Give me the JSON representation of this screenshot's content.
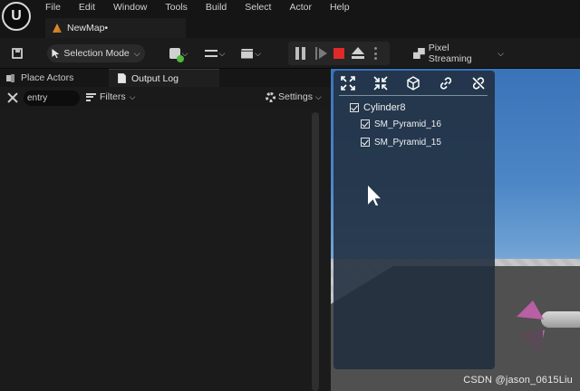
{
  "menu": {
    "items": [
      {
        "label": "File"
      },
      {
        "label": "Edit"
      },
      {
        "label": "Window"
      },
      {
        "label": "Tools"
      },
      {
        "label": "Build"
      },
      {
        "label": "Select"
      },
      {
        "label": "Actor"
      },
      {
        "label": "Help"
      }
    ]
  },
  "logo_icon": "unreal-logo-icon",
  "logo_mark": "U",
  "map_tab": {
    "label": "NewMap•"
  },
  "toolbar": {
    "selection_mode": "Selection Mode",
    "chevron": "⌵",
    "pixel_streaming": "Pixel Streaming",
    "stop_color": "#e02a2a"
  },
  "panels": {
    "tabs": [
      {
        "label": "Place Actors"
      },
      {
        "label": "Output Log"
      }
    ]
  },
  "filterbar": {
    "search_value": "entry",
    "filters_label": "Filters",
    "settings_label": "Settings"
  },
  "overlay": {
    "root": {
      "label": "Cylinder8"
    },
    "children": [
      {
        "label": "SM_Pyramid_16"
      },
      {
        "label": "SM_Pyramid_15"
      }
    ]
  },
  "watermark": "CSDN @jason_0615Liu"
}
